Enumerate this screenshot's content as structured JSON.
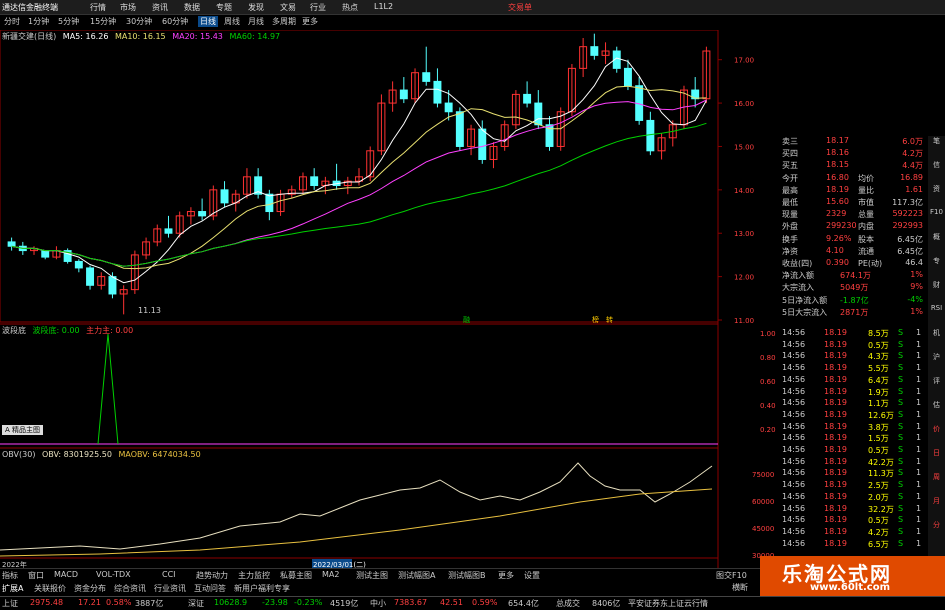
{
  "titlebar": {
    "app": "通达信金融终端",
    "menus": [
      "行情",
      "市场",
      "资讯",
      "数据",
      "专题",
      "发现",
      "文易",
      "行业",
      "热点",
      "L1L2"
    ],
    "right": "交易单"
  },
  "periods": [
    "分时",
    "1分钟",
    "5分钟",
    "15分钟",
    "30分钟",
    "60分钟",
    "日线",
    "周线",
    "月线",
    "多周期",
    "更多"
  ],
  "active_period": "日线",
  "ma_legend": {
    "name": "新疆交建(日线)",
    "ma5": "MA5: 16.26",
    "ma10": "MA10: 16.15",
    "ma20": "MA20: 15.43",
    "ma60": "MA60: 14.97"
  },
  "colors": {
    "up": "#ff3232",
    "down": "#54ffff",
    "ma5": "#ffffff",
    "ma10": "#e8e070",
    "ma20": "#ff40ff",
    "ma60": "#00d000",
    "accent": "#ffff00"
  },
  "price_axis": [
    "17.00",
    "16.00",
    "15.00",
    "14.00",
    "13.00",
    "12.00",
    "11.00"
  ],
  "low_label": "11.13",
  "event_marks": [
    "融",
    "榜",
    "转"
  ],
  "indicator1": {
    "name": "波段底",
    "label1": "波段底: 0.00",
    "label2": "主力主: 0.00",
    "axis": [
      "1.00",
      "0.80",
      "0.60",
      "0.40",
      "0.20"
    ]
  },
  "badge": "A 精品主图",
  "indicator2": {
    "name": "OBV(30)",
    "obv": "OBV: 8301925.50",
    "maobv": "MAOBV: 6474034.50",
    "axis": [
      "75000",
      "60000",
      "45000",
      "30000"
    ]
  },
  "date_axis": {
    "start": "2022年",
    "marker": "2022/03/01(二)"
  },
  "quote": {
    "rows": [
      {
        "label": "卖三",
        "value": "18.17",
        "right": "6.0万"
      },
      {
        "label": "买四",
        "value": "18.16",
        "right": "4.2万"
      },
      {
        "label": "买五",
        "value": "18.15",
        "right": "4.4万"
      },
      {
        "label": "今开",
        "value": "16.80",
        "label2": "均价",
        "right": "16.89"
      },
      {
        "label": "最高",
        "value": "18.19",
        "label2": "量比",
        "right": "1.61"
      },
      {
        "label": "最低",
        "value": "15.60",
        "label2": "市值",
        "right": "117.3亿"
      },
      {
        "label": "现量",
        "value": "2329",
        "label2": "总量",
        "right": "592223"
      },
      {
        "label": "外盘",
        "value": "299230",
        "label2": "内盘",
        "right": "292993"
      },
      {
        "label": "换手",
        "value": "9.26%",
        "label2": "股本",
        "right": "6.45亿"
      },
      {
        "label": "净资",
        "value": "4.10",
        "label2": "流通",
        "right": "6.45亿"
      },
      {
        "label": "收益(四)",
        "value": "0.390",
        "label2": "PE(动)",
        "right": "46.4"
      },
      {
        "label": "净流入额",
        "value": "674.1万",
        "right": "1%"
      },
      {
        "label": "大宗流入",
        "value": "5049万",
        "right": "9%"
      },
      {
        "label": "5日净流入额",
        "value": "-1.87亿",
        "right": "-4%"
      },
      {
        "label": "5日大宗流入",
        "value": "2871万",
        "right": "1%"
      }
    ]
  },
  "ticks": [
    {
      "time": "14:56",
      "price": "18.19",
      "vol": "8.5万",
      "side": "S",
      "n": "1"
    },
    {
      "time": "14:56",
      "price": "18.19",
      "vol": "0.5万",
      "side": "S",
      "n": "1"
    },
    {
      "time": "14:56",
      "price": "18.19",
      "vol": "4.3万",
      "side": "S",
      "n": "1"
    },
    {
      "time": "14:56",
      "price": "18.19",
      "vol": "5.5万",
      "side": "S",
      "n": "1"
    },
    {
      "time": "14:56",
      "price": "18.19",
      "vol": "6.4万",
      "side": "S",
      "n": "1"
    },
    {
      "time": "14:56",
      "price": "18.19",
      "vol": "1.9万",
      "side": "S",
      "n": "1"
    },
    {
      "time": "14:56",
      "price": "18.19",
      "vol": "1.1万",
      "side": "S",
      "n": "1"
    },
    {
      "time": "14:56",
      "price": "18.19",
      "vol": "12.6万",
      "side": "S",
      "n": "1"
    },
    {
      "time": "14:56",
      "price": "18.19",
      "vol": "3.8万",
      "side": "S",
      "n": "1"
    },
    {
      "time": "14:56",
      "price": "18.19",
      "vol": "1.5万",
      "side": "S",
      "n": "1"
    },
    {
      "time": "14:56",
      "price": "18.19",
      "vol": "0.5万",
      "side": "S",
      "n": "1"
    },
    {
      "time": "14:56",
      "price": "18.19",
      "vol": "42.2万",
      "side": "S",
      "n": "1"
    },
    {
      "time": "14:56",
      "price": "18.19",
      "vol": "11.3万",
      "side": "S",
      "n": "1"
    },
    {
      "time": "14:56",
      "price": "18.19",
      "vol": "2.5万",
      "side": "S",
      "n": "1"
    },
    {
      "time": "14:56",
      "price": "18.19",
      "vol": "2.0万",
      "side": "S",
      "n": "1"
    },
    {
      "time": "14:56",
      "price": "18.19",
      "vol": "32.2万",
      "side": "S",
      "n": "1"
    },
    {
      "time": "14:56",
      "price": "18.19",
      "vol": "0.5万",
      "side": "S",
      "n": "1"
    },
    {
      "time": "14:56",
      "price": "18.19",
      "vol": "4.2万",
      "side": "S",
      "n": "1"
    },
    {
      "time": "14:56",
      "price": "18.19",
      "vol": "6.5万",
      "side": "S",
      "n": "1"
    }
  ],
  "sidebar_labels": [
    "笔",
    "信",
    "资",
    "F10",
    "概",
    "专",
    "财",
    "RSI",
    "机",
    "沪",
    "评",
    "估",
    "价",
    "日",
    "周",
    "月",
    "分"
  ],
  "bottom_tabs": [
    "指标",
    "窗口",
    "MACD",
    "VOL-TDX",
    "CCI",
    "趋势动力",
    "主力监控",
    "私募主图",
    "MA2",
    "测试主图",
    "测试幅图A",
    "测试幅图B",
    "更多",
    "设置"
  ],
  "bottom_tabs2": [
    "扩展A",
    "关联报价",
    "资金分布",
    "综合资讯",
    "行业资讯",
    "互动问答",
    "新用户福利专享"
  ],
  "bottom_right": {
    "left": "图交F10",
    "right": "横断"
  },
  "status": {
    "sh_label": "上证",
    "sh_val": "2975.48",
    "sh_chg": "17.21",
    "sh_pct": "0.58%",
    "sh_amt": "3887亿",
    "sz_label": "深证",
    "sz_val": "10628.9",
    "sz_chg": "-23.98",
    "sz_pct": "-0.23%",
    "sz_amt": "4519亿",
    "zx_label": "中小",
    "zx_val": "7383.67",
    "zx_chg": "42.51",
    "zx_pct": "0.59%",
    "zx_amt": "654.4亿",
    "total_label": "总成交",
    "total_val": "8406亿",
    "broker": "平安证券东上证云行情"
  },
  "ad": {
    "title": "乐淘公式网",
    "url": "www.60lt.com"
  },
  "chart_data": {
    "type": "candlestick",
    "ylim": [
      11,
      17.5
    ],
    "candles": [
      [
        12.8,
        12.9,
        12.6,
        12.7
      ],
      [
        12.7,
        12.8,
        12.5,
        12.6
      ],
      [
        12.6,
        12.7,
        12.5,
        12.65
      ],
      [
        12.6,
        12.6,
        12.4,
        12.45
      ],
      [
        12.45,
        12.7,
        12.4,
        12.6
      ],
      [
        12.6,
        12.65,
        12.3,
        12.35
      ],
      [
        12.35,
        12.4,
        12.1,
        12.2
      ],
      [
        12.2,
        12.25,
        11.7,
        11.8
      ],
      [
        11.8,
        12.1,
        11.7,
        12.0
      ],
      [
        12.0,
        12.1,
        11.5,
        11.6
      ],
      [
        11.6,
        11.8,
        11.13,
        11.7
      ],
      [
        11.7,
        12.6,
        11.6,
        12.5
      ],
      [
        12.5,
        12.9,
        12.4,
        12.8
      ],
      [
        12.8,
        13.2,
        12.7,
        13.1
      ],
      [
        13.1,
        13.4,
        12.9,
        13.0
      ],
      [
        13.0,
        13.5,
        12.9,
        13.4
      ],
      [
        13.4,
        13.6,
        13.2,
        13.5
      ],
      [
        13.5,
        13.8,
        13.3,
        13.4
      ],
      [
        13.4,
        14.1,
        13.3,
        14.0
      ],
      [
        14.0,
        14.2,
        13.6,
        13.7
      ],
      [
        13.7,
        14.0,
        13.5,
        13.9
      ],
      [
        13.9,
        14.5,
        13.8,
        14.3
      ],
      [
        14.3,
        14.5,
        13.8,
        13.9
      ],
      [
        13.9,
        14.0,
        13.3,
        13.5
      ],
      [
        13.5,
        14.0,
        13.4,
        13.9
      ],
      [
        13.9,
        14.1,
        13.8,
        14.0
      ],
      [
        14.0,
        14.4,
        13.9,
        14.3
      ],
      [
        14.3,
        14.5,
        14.0,
        14.1
      ],
      [
        14.1,
        14.3,
        13.9,
        14.2
      ],
      [
        14.2,
        14.6,
        14.0,
        14.1
      ],
      [
        14.1,
        14.3,
        13.9,
        14.2
      ],
      [
        14.2,
        14.5,
        14.1,
        14.3
      ],
      [
        14.3,
        15.0,
        14.2,
        14.9
      ],
      [
        14.9,
        16.2,
        14.8,
        16.0
      ],
      [
        16.0,
        16.5,
        15.8,
        16.3
      ],
      [
        16.3,
        16.6,
        16.0,
        16.1
      ],
      [
        16.1,
        16.8,
        16.0,
        16.7
      ],
      [
        16.7,
        17.3,
        16.4,
        16.5
      ],
      [
        16.5,
        16.8,
        15.9,
        16.0
      ],
      [
        16.0,
        16.3,
        15.6,
        15.8
      ],
      [
        15.8,
        15.9,
        14.9,
        15.0
      ],
      [
        15.0,
        15.5,
        14.8,
        15.4
      ],
      [
        15.4,
        15.6,
        14.6,
        14.7
      ],
      [
        14.7,
        15.1,
        14.5,
        15.0
      ],
      [
        15.0,
        15.6,
        14.9,
        15.5
      ],
      [
        15.5,
        16.3,
        15.4,
        16.2
      ],
      [
        16.2,
        16.5,
        15.9,
        16.0
      ],
      [
        16.0,
        16.3,
        15.4,
        15.5
      ],
      [
        15.5,
        15.7,
        14.9,
        15.0
      ],
      [
        15.0,
        15.9,
        14.9,
        15.8
      ],
      [
        15.8,
        16.9,
        15.7,
        16.8
      ],
      [
        16.8,
        17.5,
        16.6,
        17.3
      ],
      [
        17.3,
        17.6,
        17.0,
        17.1
      ],
      [
        17.1,
        17.4,
        16.9,
        17.2
      ],
      [
        17.2,
        17.3,
        16.7,
        16.8
      ],
      [
        16.8,
        17.0,
        16.3,
        16.4
      ],
      [
        16.4,
        16.6,
        15.5,
        15.6
      ],
      [
        15.6,
        15.8,
        14.8,
        14.9
      ],
      [
        14.9,
        15.3,
        14.7,
        15.2
      ],
      [
        15.2,
        15.6,
        15.0,
        15.5
      ],
      [
        15.5,
        16.4,
        15.4,
        16.3
      ],
      [
        16.3,
        16.6,
        15.9,
        16.1
      ],
      [
        16.1,
        17.3,
        16.0,
        17.2
      ]
    ]
  }
}
